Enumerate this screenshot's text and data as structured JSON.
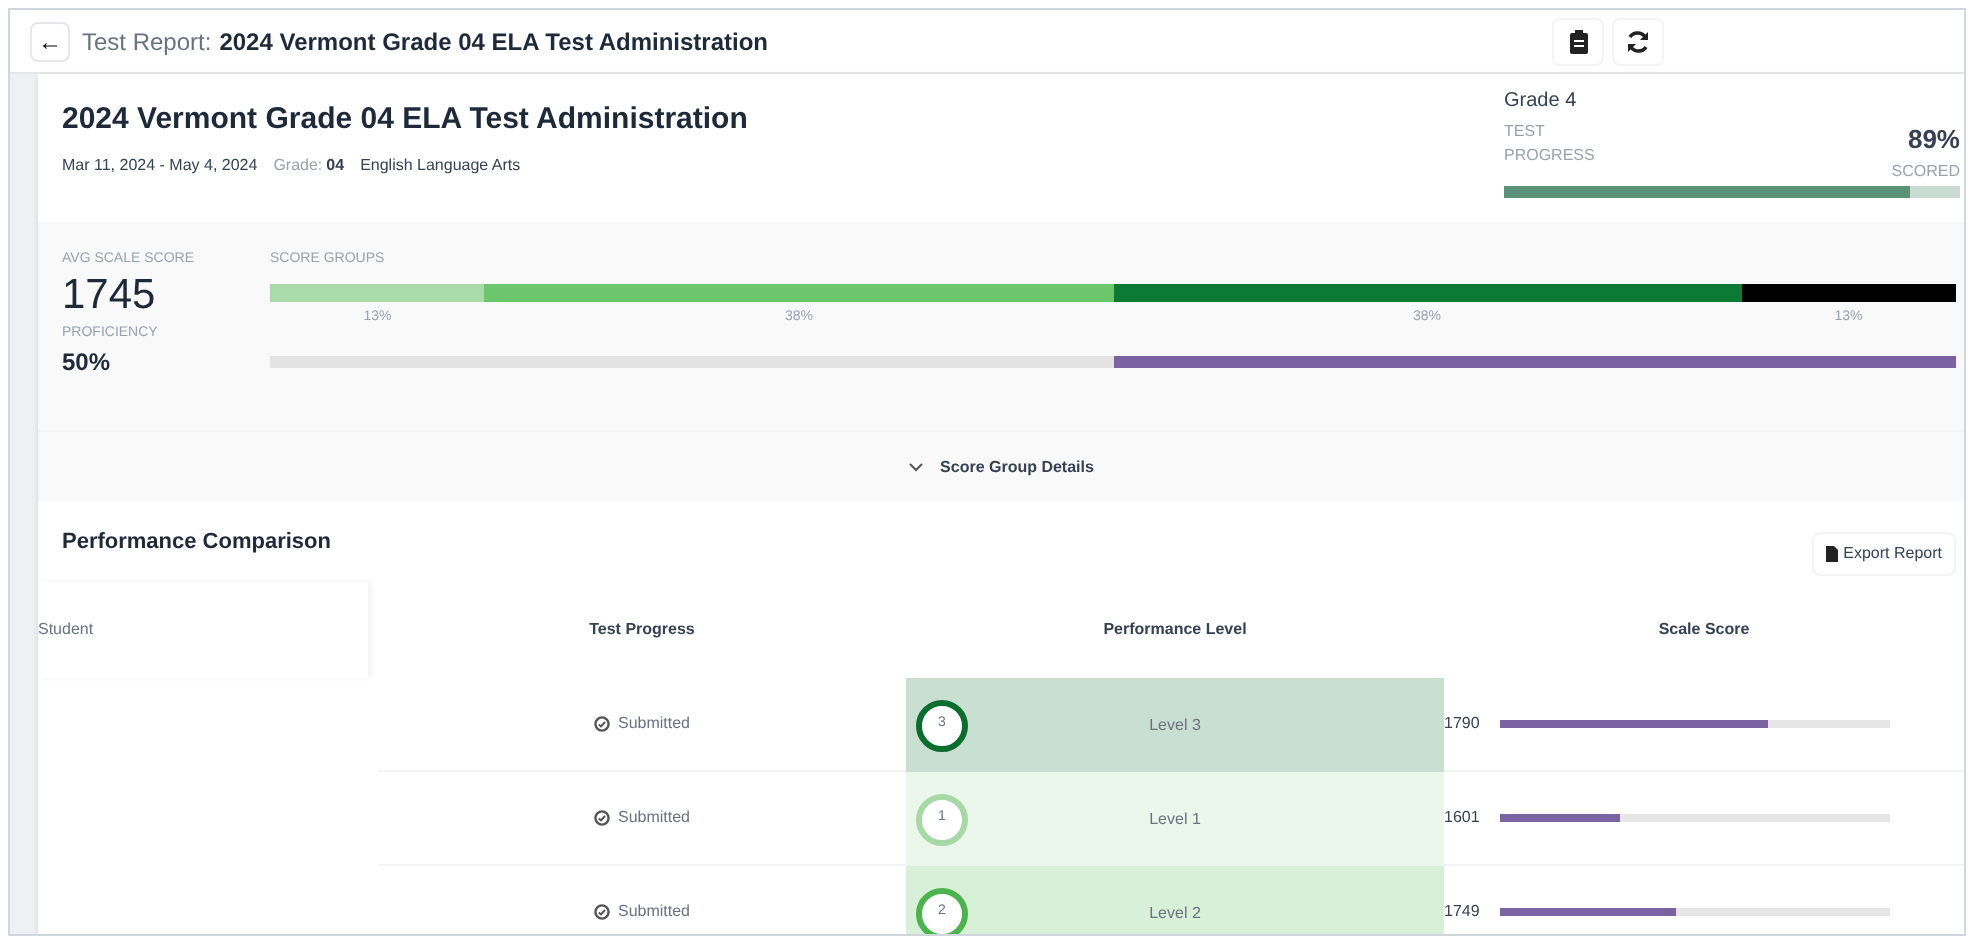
{
  "header": {
    "back": "←",
    "label": "Test Report:",
    "title": "2024 Vermont Grade 04 ELA Test Administration"
  },
  "summary": {
    "title": "2024 Vermont Grade 04 ELA Test Administration",
    "dates": "Mar 11, 2024 - May 4, 2024",
    "grade_label": "Grade:",
    "grade": "04",
    "subject": "English Language Arts"
  },
  "progress": {
    "grade": "Grade 4",
    "label": "TEST PROGRESS",
    "value": "89%",
    "value_label": "SCORED",
    "level": 0.89
  },
  "stats": {
    "avg_label": "AVG SCALE SCORE",
    "avg": "1745",
    "proficiency_label": "PROFICIENCY",
    "proficiency": "50%",
    "proficiency_bar": {
      "level": 0.5
    },
    "groups_label": "SCORE GROUPS",
    "groups": [
      {
        "label": "13%",
        "color": "#a8dba8"
      },
      {
        "label": "38%",
        "color": "#6cc76c"
      },
      {
        "label": "38%",
        "color": "#0b7a35"
      },
      {
        "label": "13%",
        "color": "#000000"
      }
    ]
  },
  "details_toggle": {
    "label": "Score Group Details",
    "expanded": false
  },
  "comparison": {
    "title": "Performance Comparison",
    "export": "Export Report",
    "columns": [
      "Student",
      "Test Progress",
      "Performance Level",
      "Scale Score"
    ],
    "rows": [
      {
        "status": "Submitted",
        "level_number": "3",
        "level_label": "Level 3",
        "color": "#0b6e2e",
        "score": "1790",
        "level": 0.69
      },
      {
        "status": "Submitted",
        "level_number": "1",
        "level_label": "Level 1",
        "color": "#a6d9a6",
        "score": "1601",
        "level": 0.31
      },
      {
        "status": "Submitted",
        "level_number": "2",
        "level_label": "Level 2",
        "color": "#4cb44c",
        "score": "1749",
        "level": 0.45
      }
    ]
  }
}
